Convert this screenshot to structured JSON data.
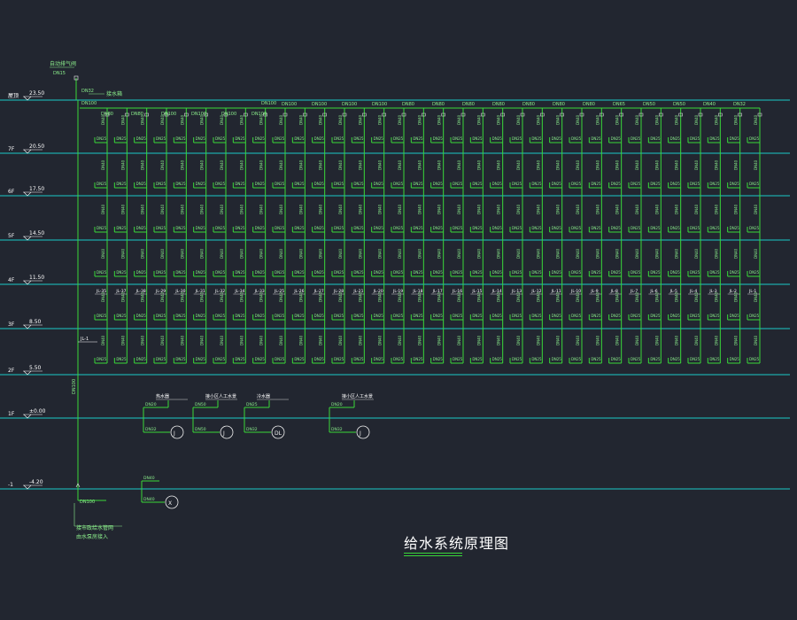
{
  "drawing": {
    "title": "给水系统原理图",
    "colors": {
      "background": "#222630",
      "floor_line": "#19c9c9",
      "pipe": "#39d839",
      "label": "#8cf08c",
      "text": "#ffffff",
      "marker": "#f0f0f0"
    }
  },
  "floors": [
    {
      "name": "屋顶",
      "elevation": "23.50"
    },
    {
      "name": "7F",
      "elevation": "20.50"
    },
    {
      "name": "6F",
      "elevation": "17.50"
    },
    {
      "name": "5F",
      "elevation": "14.50"
    },
    {
      "name": "4F",
      "elevation": "11.50"
    },
    {
      "name": "3F",
      "elevation": "8.50"
    },
    {
      "name": "2F",
      "elevation": "5.50"
    },
    {
      "name": "1F",
      "elevation": "±0.00"
    },
    {
      "name": "-1",
      "elevation": "-4.20"
    }
  ],
  "top_annotations": {
    "vent_valve": "自动排气阀",
    "vent_size": "DN15",
    "main_size": "DN32",
    "to_tank": "接水箱",
    "roof_main_left": "DN100",
    "roof_main_mid": "DN100",
    "header_sizes": [
      "DN80",
      "DN80",
      "DN100",
      "DN100",
      "DN100",
      "DN100",
      "DN100",
      "DN100",
      "DN100",
      "DN100",
      "DN80",
      "DN80",
      "DN80",
      "DN80",
      "DN80",
      "DN80",
      "DN80",
      "DN65",
      "DN50",
      "DN50",
      "DN40",
      "DN32"
    ]
  },
  "risers": {
    "count": 34,
    "branch_size": "DN25",
    "riser_size": "DN40",
    "stack_labels": [
      "JL-35",
      "JL-37",
      "JL-38",
      "JL-29",
      "JL-30",
      "JL-31",
      "JL-32",
      "JL-34",
      "JL-33",
      "JL-25",
      "JL-26",
      "JL-27",
      "JL-28",
      "JL-21",
      "JL-20",
      "JL-19",
      "JL-18",
      "JL-17",
      "JL-16",
      "JL-15",
      "JL-14",
      "JL-13",
      "JL-12",
      "JL-11",
      "JL-10",
      "JL-9",
      "JL-8",
      "JL-7",
      "JL-6",
      "JL-5",
      "JL-4",
      "JL-3",
      "JL-2",
      "JL-1"
    ]
  },
  "main_riser": {
    "label": "JL-1",
    "size": "DN100",
    "bottom_size": "DN100"
  },
  "ground_fixtures": [
    {
      "label": "热水器",
      "pipe": "DN20",
      "drop": "DN32",
      "tag": "J"
    },
    {
      "label": "接小区人工水景",
      "pipe": "DN50",
      "drop": "DN50",
      "tag": "J"
    },
    {
      "label": "冷水器",
      "pipe": "DN25",
      "drop": "DN32",
      "tag": "DL"
    },
    {
      "label": "接小区人工水景",
      "pipe": "DN20",
      "drop": "DN32",
      "tag": "J"
    }
  ],
  "basement_fixture": {
    "pipe": "DN40",
    "drop": "DN40",
    "tag": "X"
  },
  "source": {
    "label1": "接市政给水管网",
    "label2": "由水泵房接入"
  }
}
